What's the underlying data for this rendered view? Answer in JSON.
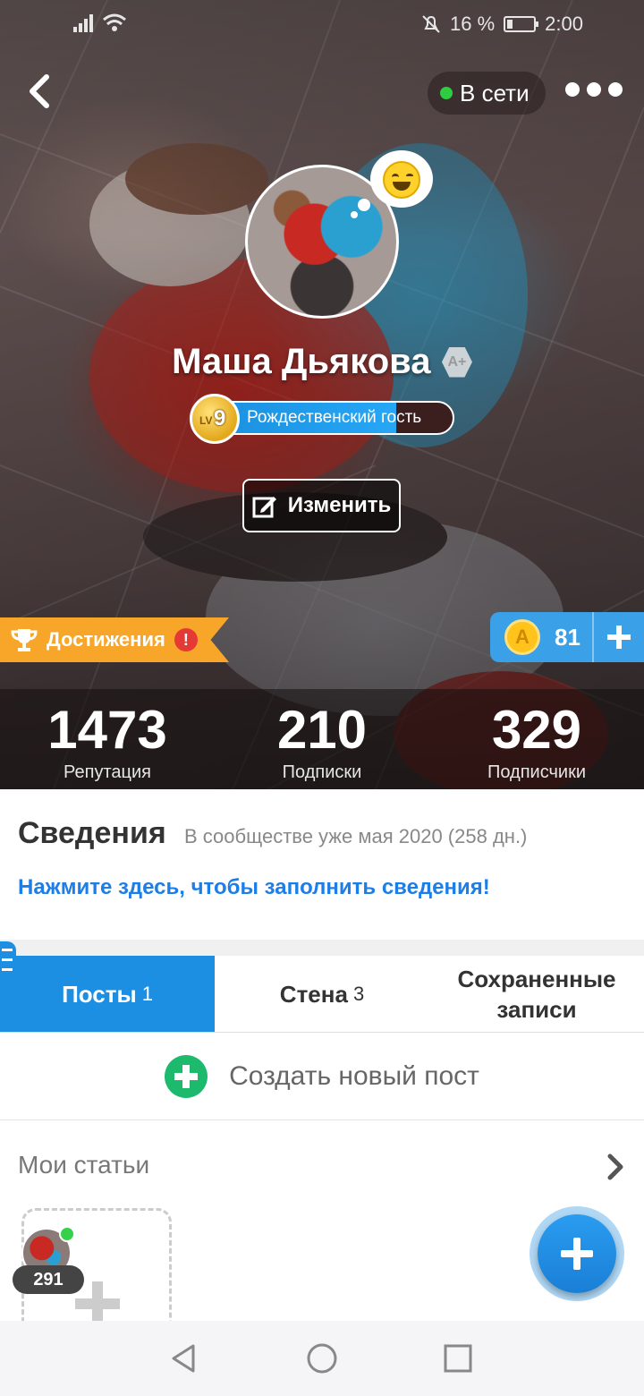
{
  "status_bar": {
    "battery_percent": "16 %",
    "time": "2:00"
  },
  "header": {
    "online_status": "В сети",
    "accent_online": "#2ecc40"
  },
  "profile": {
    "name": "Маша Дьякова",
    "badge": "A+",
    "level_prefix": "LV",
    "level": "9",
    "level_title": "Рождественский гость",
    "level_progress": 0.77,
    "edit_label": "Изменить"
  },
  "achievements": {
    "label": "Достижения",
    "alert": "!"
  },
  "coins": {
    "symbol": "A",
    "value": "81"
  },
  "stats": [
    {
      "value": "1473",
      "label": "Репутация"
    },
    {
      "value": "210",
      "label": "Подписки"
    },
    {
      "value": "329",
      "label": "Подписчики"
    }
  ],
  "about": {
    "title": "Сведения",
    "since": "В сообществе уже мая 2020 (258 дн.)",
    "fill_link": "Нажмите здесь, чтобы заполнить сведения!"
  },
  "tabs": [
    {
      "label": "Посты",
      "count": "1"
    },
    {
      "label": "Стена",
      "count": "3"
    },
    {
      "label": "Сохраненные записи",
      "count": ""
    }
  ],
  "create_post": {
    "label": "Создать новый пост"
  },
  "articles": {
    "title": "Мои статьи",
    "draft_count": "291"
  },
  "colors": {
    "primary": "#1d8fe3",
    "link": "#1e7ee8",
    "achievement": "#f7a62a",
    "create": "#1db96d"
  }
}
